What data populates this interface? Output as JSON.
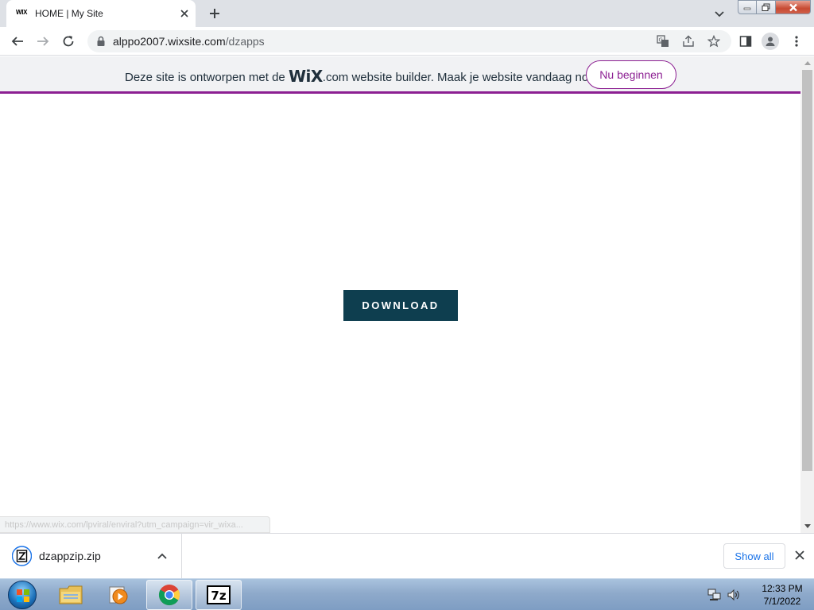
{
  "browser": {
    "tab": {
      "favicon_text": "WIX",
      "title": "HOME | My Site"
    },
    "url": {
      "host": "alppo2007.wixsite.com",
      "path": "/dzapps"
    }
  },
  "banner": {
    "text_before": "Deze site is ontworpen met de",
    "logo": "WiX",
    "text_after": ".com website builder. Maak je website vandaag nog.",
    "button_label": "Nu beginnen",
    "accent_color": "#8c1f92"
  },
  "page": {
    "download_label": "DOWNLOAD",
    "download_color": "#0e3e4f",
    "status_url": "https://www.wix.com/lpviral/enviral?utm_campaign=vir_wixa..."
  },
  "download_shelf": {
    "file_name": "dzappzip.zip",
    "show_all_label": "Show all"
  },
  "taskbar": {
    "apps": [
      "explorer-icon",
      "media-player-icon",
      "chrome-icon",
      "7zip-icon"
    ],
    "sevenzip_label": "7z",
    "time": "12:33 PM",
    "date": "7/1/2022"
  }
}
